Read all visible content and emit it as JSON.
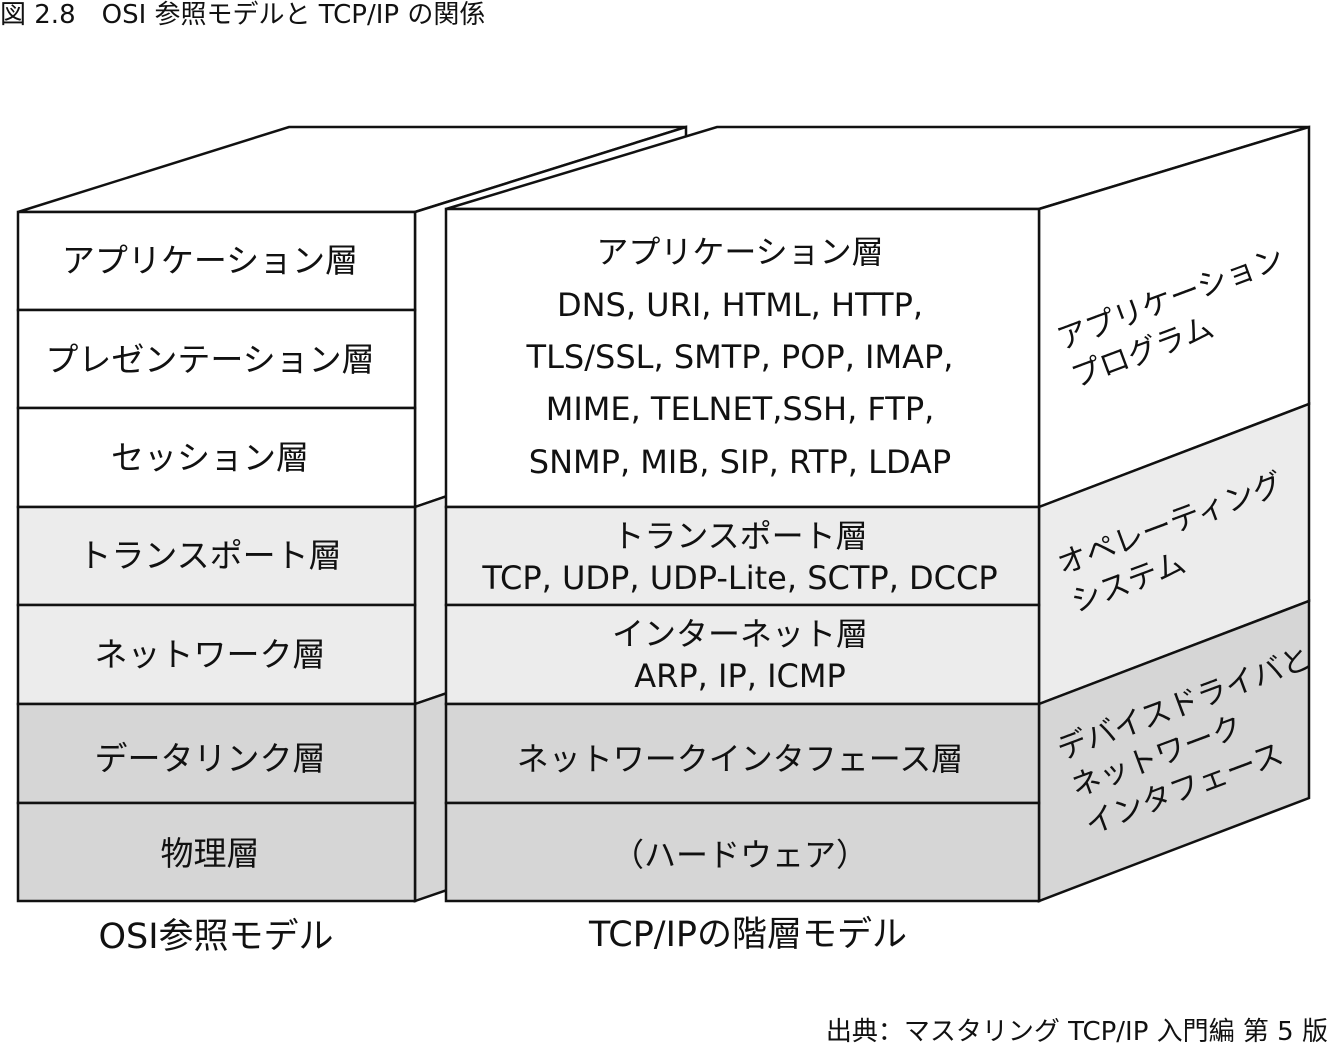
{
  "figure_caption": "図 2.8　OSI 参照モデルと TCP/IP の関係",
  "source": "出典：マスタリング TCP/IP 入門編 第 5 版",
  "colors": {
    "white": "#ffffff",
    "light_gray": "#ececec",
    "mid_gray": "#d6d6d6",
    "stroke": "#111111"
  },
  "osi": {
    "title": "OSI参照モデル",
    "layers": [
      "アプリケーション層",
      "プレゼンテーション層",
      "セッション層",
      "トランスポート層",
      "ネットワーク層",
      "データリンク層",
      "物理層"
    ]
  },
  "tcpip": {
    "title": "TCP/IPの階層モデル",
    "application": {
      "name": "アプリケーション層",
      "protocol_lines": [
        "DNS, URI, HTML, HTTP,",
        "TLS/SSL, SMTP, POP, IMAP,",
        "MIME, TELNET,SSH, FTP,",
        "SNMP, MIB, SIP, RTP, LDAP"
      ]
    },
    "transport": {
      "name": "トランスポート層",
      "protocols": "TCP, UDP, UDP-Lite, SCTP, DCCP"
    },
    "internet": {
      "name": "インターネット層",
      "protocols": "ARP, IP, ICMP"
    },
    "network_interface": {
      "name": "ネットワークインタフェース層"
    },
    "hardware": {
      "name": "（ハードウェア）"
    }
  },
  "side_labels": {
    "application_program": [
      "アプリケーション",
      "プログラム"
    ],
    "operating_system": [
      "オペレーティング",
      "システム"
    ],
    "device_driver": [
      "デバイスドライバと",
      "ネットワーク",
      "インタフェース"
    ]
  }
}
